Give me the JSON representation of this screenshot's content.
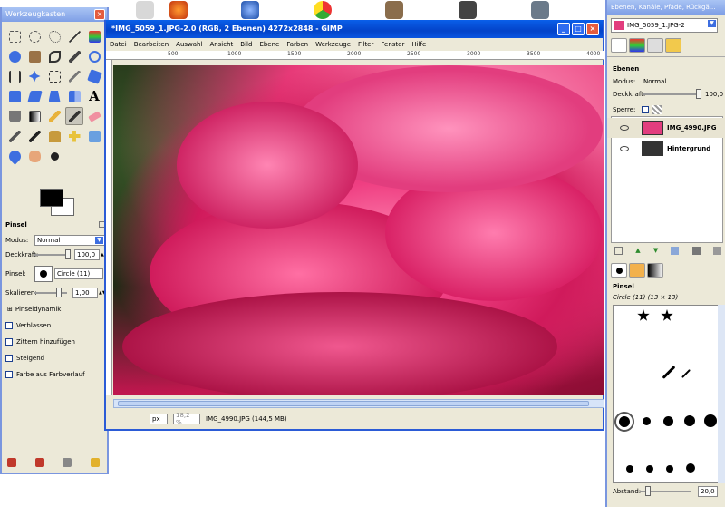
{
  "toolbox": {
    "title": "Werkzeugkasten",
    "close": "×",
    "text_tool": "A",
    "options": {
      "heading": "Pinsel",
      "mode_label": "Modus:",
      "mode_value": "Normal",
      "opacity_label": "Deckkraft:",
      "opacity_value": "100,0",
      "brush_label": "Pinsel:",
      "brush_value": "Circle (11)",
      "scale_label": "Skalieren:",
      "scale_value": "1,00",
      "dynamics_label": "Pinseldynamik",
      "checkboxes": [
        "Verblassen",
        "Zittern hinzufügen",
        "Steigend",
        "Farbe aus Farbverlauf"
      ]
    }
  },
  "image_window": {
    "title": "*IMG_5059_1.JPG-2.0 (RGB, 2 Ebenen) 4272x2848 - GIMP",
    "buttons": {
      "minimize": "_",
      "maximize": "□",
      "close": "×"
    },
    "menu": [
      "Datei",
      "Bearbeiten",
      "Auswahl",
      "Ansicht",
      "Bild",
      "Ebene",
      "Farben",
      "Werkzeuge",
      "Filter",
      "Fenster",
      "Hilfe"
    ],
    "ruler_ticks": [
      "500",
      "1000",
      "1500",
      "2000",
      "2500",
      "3000",
      "3500",
      "4000"
    ],
    "status": {
      "unit": "px",
      "zoom": "18,2 %",
      "info": "IMG_4990.JPG (144,5 MB)"
    }
  },
  "dock": {
    "title": "Ebenen, Kanäle, Pfade, Rückgä...",
    "image_select": "IMG_5059_1.JPG-2",
    "layers_heading": "Ebenen",
    "mode_label": "Modus:",
    "mode_value": "Normal",
    "opacity_label": "Deckkraft:",
    "opacity_value": "100,0",
    "lock_label": "Sperre:",
    "layers": [
      {
        "name": "IMG_4990.JPG",
        "selected": true
      },
      {
        "name": "Hintergrund",
        "selected": false
      }
    ],
    "brushes_heading": "Pinsel",
    "brush_info": "Circle (11) (13 × 13)",
    "spacing_label": "Abstand:",
    "spacing_value": "20,0"
  },
  "colors": {
    "accent": "#0343c9",
    "rose": "#e23d7e"
  }
}
